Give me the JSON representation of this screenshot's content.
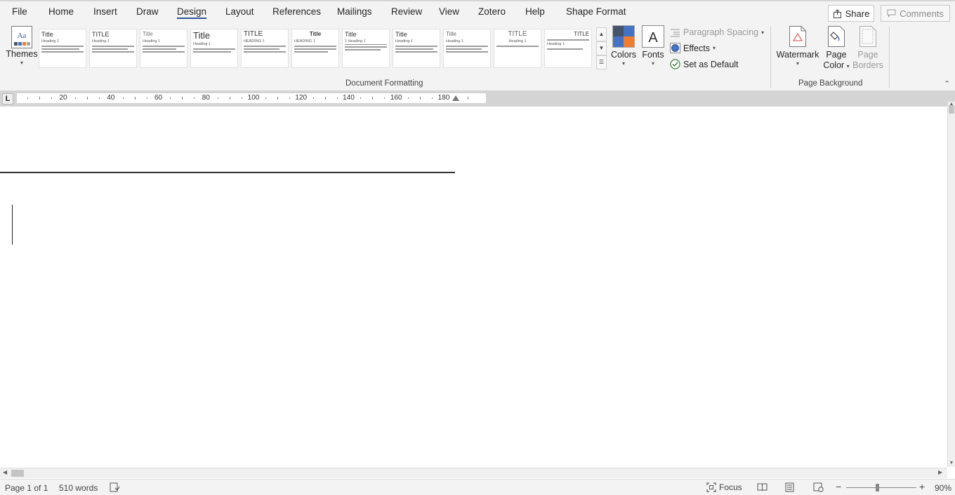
{
  "tabs": [
    {
      "label": "File",
      "active": false
    },
    {
      "label": "Home",
      "active": false
    },
    {
      "label": "Insert",
      "active": false
    },
    {
      "label": "Draw",
      "active": false
    },
    {
      "label": "Design",
      "active": true
    },
    {
      "label": "Layout",
      "active": false
    },
    {
      "label": "References",
      "active": false
    },
    {
      "label": "Mailings",
      "active": false
    },
    {
      "label": "Review",
      "active": false
    },
    {
      "label": "View",
      "active": false
    },
    {
      "label": "Zotero",
      "active": false
    },
    {
      "label": "Help",
      "active": false
    },
    {
      "label": "Shape Format",
      "active": false
    }
  ],
  "share_label": "Share",
  "comments_label": "Comments",
  "ribbon": {
    "themes_label": "Themes",
    "gallery": [
      {
        "title": "Title",
        "heading": "Heading 1"
      },
      {
        "title": "TITLE",
        "heading": "Heading 1"
      },
      {
        "title": "Title",
        "heading": "Heading 1"
      },
      {
        "title": "Title",
        "heading": "Heading 1"
      },
      {
        "title": "TITLE",
        "heading": "HEADING 1"
      },
      {
        "title": "Title",
        "heading": "HEADING 1"
      },
      {
        "title": "Title",
        "heading": "1   Heading 1"
      },
      {
        "title": "Title",
        "heading": "Heading 1"
      },
      {
        "title": "Title",
        "heading": "Heading 1"
      },
      {
        "title": "TITLE",
        "heading": "Heading 1"
      },
      {
        "title": "TITLE",
        "heading": "Heading 1"
      }
    ],
    "colors_label": "Colors",
    "fonts_label": "Fonts",
    "paragraph_spacing_label": "Paragraph Spacing",
    "effects_label": "Effects",
    "set_default_label": "Set as Default",
    "document_formatting_label": "Document Formatting",
    "watermark_label": "Watermark",
    "page_color_label_1": "Page",
    "page_color_label_2": "Color",
    "page_borders_label_1": "Page",
    "page_borders_label_2": "Borders",
    "page_background_label": "Page Background",
    "color_swatches": [
      "#44546a",
      "#4472c4",
      "#ffffff",
      "#ed7d31"
    ]
  },
  "ruler": {
    "labels": [
      "20",
      "40",
      "60",
      "80",
      "100",
      "120",
      "140",
      "160",
      "180"
    ],
    "tab_selector": "L"
  },
  "status": {
    "page": "Page 1 of 1",
    "words": "510 words",
    "focus_label": "Focus",
    "zoom_minus": "−",
    "zoom_plus": "+",
    "zoom_level": "90%"
  },
  "accent_color": "#2b579a"
}
